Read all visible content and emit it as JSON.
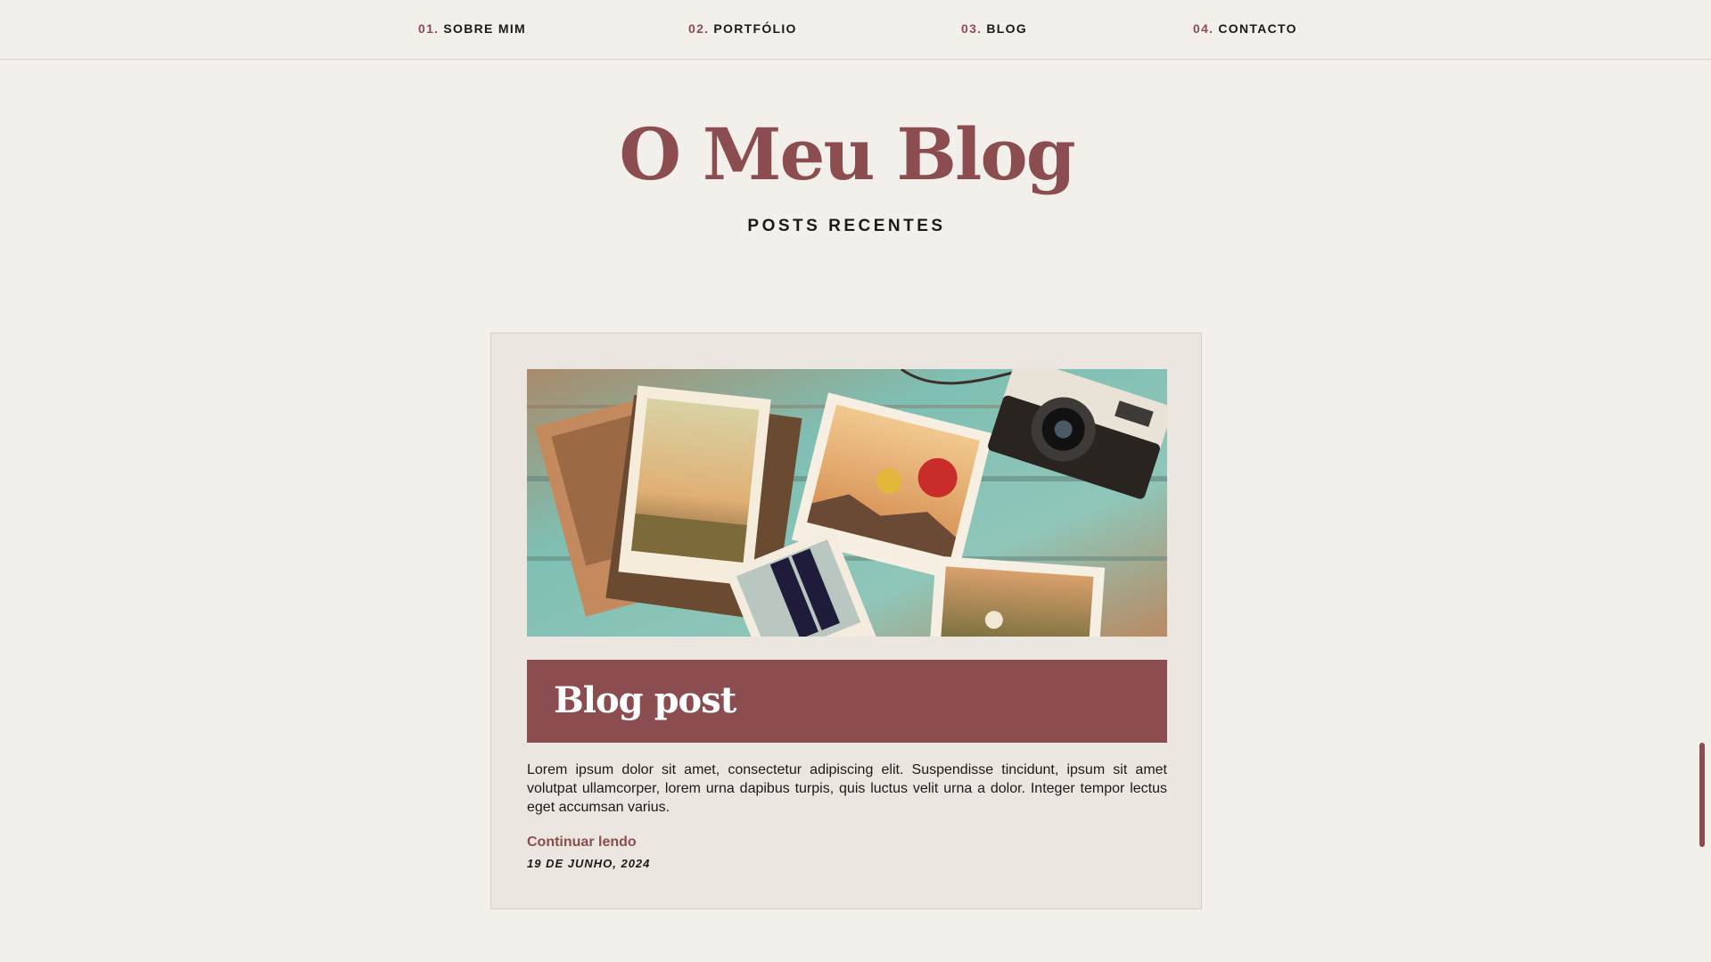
{
  "nav": {
    "items": [
      {
        "number": "01.",
        "label": "SOBRE MIM"
      },
      {
        "number": "02.",
        "label": "PORTFÓLIO"
      },
      {
        "number": "03.",
        "label": "BLOG"
      },
      {
        "number": "04.",
        "label": "CONTACTO"
      }
    ]
  },
  "header": {
    "title": "O Meu Blog",
    "subtitle": "POSTS RECENTES"
  },
  "post": {
    "image_icon": "photo-collage-image",
    "title": "Blog post",
    "excerpt": "Lorem ipsum dolor sit amet, consectetur adipiscing elit. Suspendisse tincidunt, ipsum sit amet volutpat ullamcorper, lorem urna dapibus turpis, quis luctus velit urna a dolor. Integer tempor lectus eget accumsan varius.",
    "read_more": "Continuar lendo",
    "date": "19 DE JUNHO, 2024"
  },
  "colors": {
    "accent": "#8b4d4f",
    "background": "#f3f0eb",
    "card": "#ebe6e0",
    "text": "#1a1a1a"
  }
}
